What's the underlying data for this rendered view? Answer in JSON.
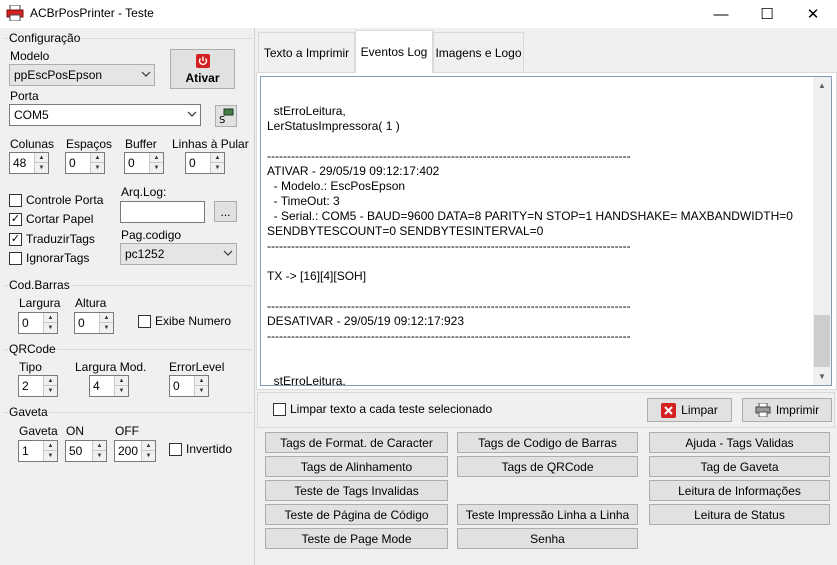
{
  "window": {
    "title": "ACBrPosPrinter - Teste",
    "controls": {
      "minimize": "—",
      "maximize": "☐",
      "close": "✕"
    }
  },
  "config": {
    "group_label": "Configuração",
    "modelo_label": "Modelo",
    "modelo_value": "ppEscPosEpson",
    "ativar_label": "Ativar",
    "porta_label": "Porta",
    "porta_value": "COM5",
    "colunas_label": "Colunas",
    "colunas_value": "48",
    "espacos_label": "Espaços",
    "espacos_value": "0",
    "buffer_label": "Buffer",
    "buffer_value": "0",
    "linhas_label": "Linhas à Pular",
    "linhas_value": "0",
    "controle_porta": {
      "label": "Controle Porta",
      "checked": false
    },
    "cortar_papel": {
      "label": "Cortar Papel",
      "checked": true
    },
    "traduzir_tags": {
      "label": "TraduzirTags",
      "checked": true
    },
    "ignorar_tags": {
      "label": "IgnorarTags",
      "checked": false
    },
    "arqlog_label": "Arq.Log:",
    "arqlog_value": "",
    "browse_label": "...",
    "pagcodigo_label": "Pag.codigo",
    "pagcodigo_value": "pc1252"
  },
  "codbarras": {
    "group_label": "Cod.Barras",
    "largura_label": "Largura",
    "largura_value": "0",
    "altura_label": "Altura",
    "altura_value": "0",
    "exibe_numero": {
      "label": "Exibe Numero",
      "checked": false
    }
  },
  "qrcode": {
    "group_label": "QRCode",
    "tipo_label": "Tipo",
    "tipo_value": "2",
    "largura_mod_label": "Largura Mod.",
    "largura_mod_value": "4",
    "error_level_label": "ErrorLevel",
    "error_level_value": "0"
  },
  "gaveta": {
    "group_label": "Gaveta",
    "gaveta_label": "Gaveta",
    "gaveta_value": "1",
    "on_label": "ON",
    "on_value": "50",
    "off_label": "OFF",
    "off_value": "200",
    "invertido": {
      "label": "Invertido",
      "checked": false
    }
  },
  "tabs": [
    {
      "label": "Texto a Imprimir",
      "active": false
    },
    {
      "label": "Eventos Log",
      "active": true
    },
    {
      "label": "Imagens e Logo",
      "active": false
    }
  ],
  "log_text": "\n  stErroLeitura,\nLerStatusImpressora( 1 )\n\n-------------------------------------------------------------------------------------------\nATIVAR - 29/05/19 09:12:17:402\n  - Modelo.: EscPosEpson\n  - TimeOut: 3\n  - Serial.: COM5 - BAUD=9600 DATA=8 PARITY=N STOP=1 HANDSHAKE= MAXBANDWIDTH=0\nSENDBYTESCOUNT=0 SENDBYTESINTERVAL=0\n-------------------------------------------------------------------------------------------\n\nTX -> [16][4][SOH]\n\n-------------------------------------------------------------------------------------------\nDESATIVAR - 29/05/19 09:12:17:923\n-------------------------------------------------------------------------------------------\n\n\n  stErroLeitura,",
  "limpar_cada": {
    "label": "Limpar texto a cada teste selecionado",
    "checked": false
  },
  "limpar_label": "Limpar",
  "imprimir_label": "Imprimir",
  "test_buttons": [
    "Tags de Format. de Caracter",
    "Tags de Codigo de Barras",
    "Ajuda - Tags Validas",
    "Tags de Alinhamento",
    "Tags de QRCode",
    "Tag de Gaveta",
    "Teste de Tags Invalidas",
    "Leitura de Informações",
    "Teste de Página de Código",
    "Teste Impressão Linha a Linha",
    "Leitura de Status",
    "Teste de Page Mode",
    "Senha"
  ],
  "colors": {
    "accent_red": "#d32020",
    "window_bg": "#f0f0f0",
    "log_border": "#7f9db9"
  }
}
